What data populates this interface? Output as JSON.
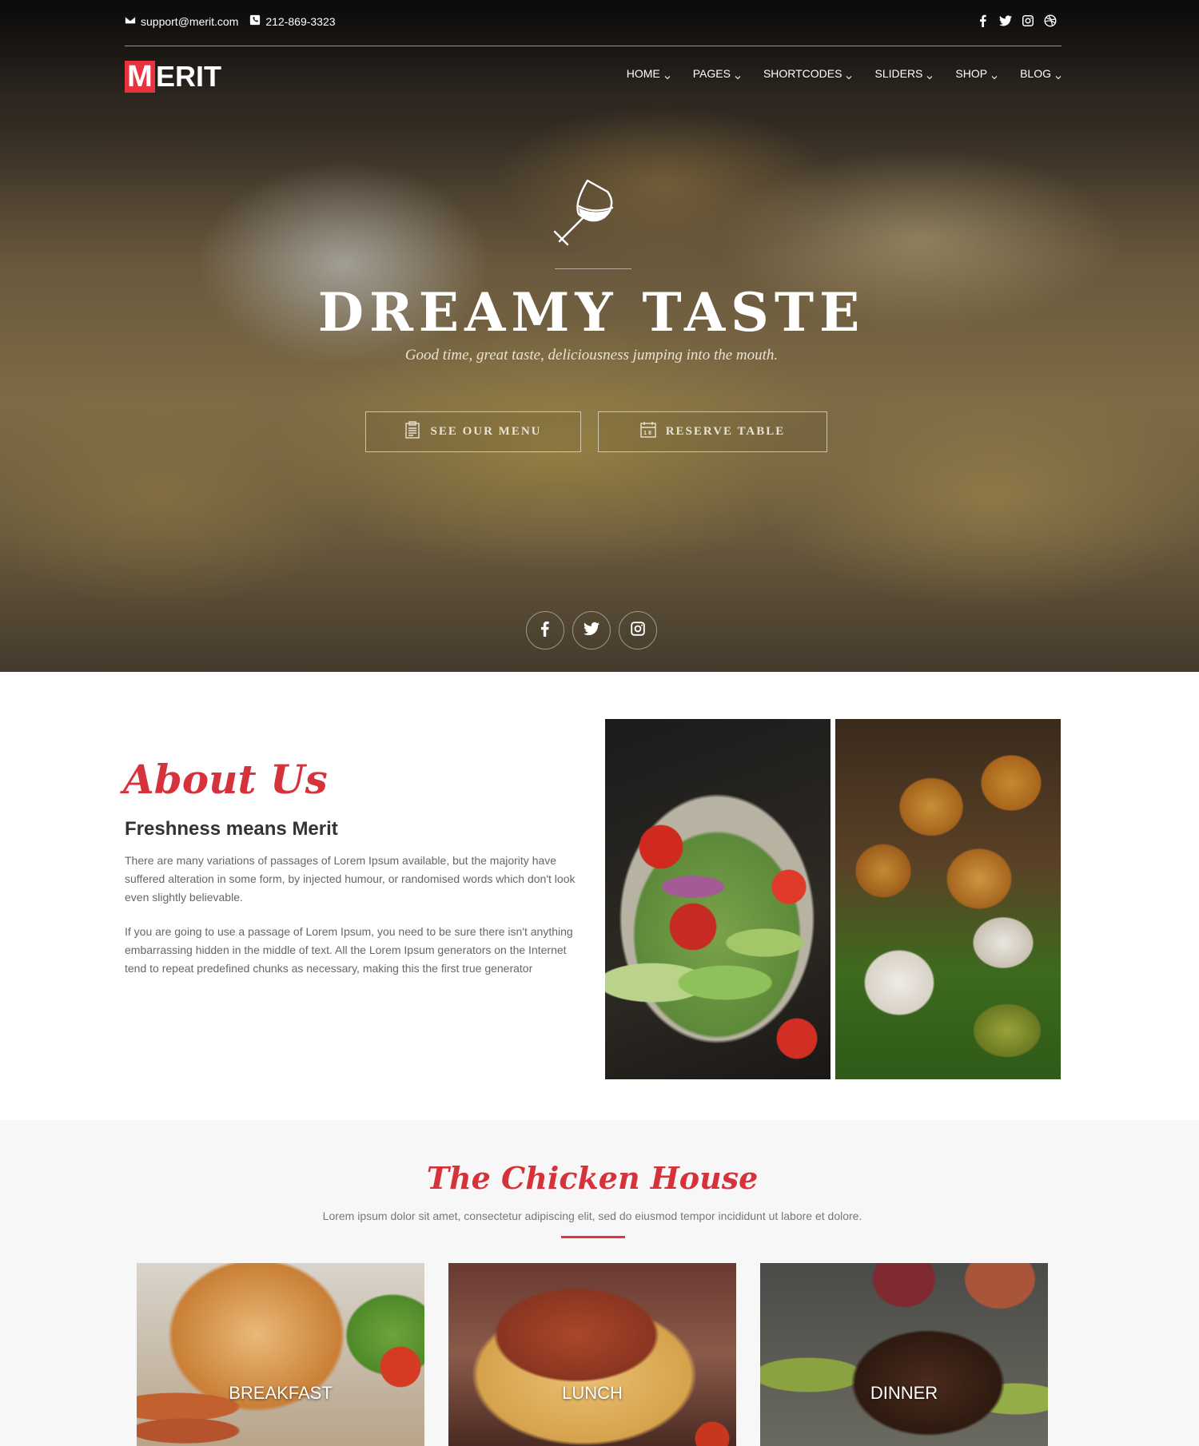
{
  "topbar": {
    "email": "support@merit.com",
    "phone": "212-869-3323",
    "social_icons": [
      "facebook-icon",
      "twitter-icon",
      "instagram-icon",
      "dribbble-icon"
    ]
  },
  "logo": {
    "first_letter": "M",
    "rest": "ERIT"
  },
  "nav": {
    "items": [
      {
        "label": "HOME"
      },
      {
        "label": "PAGES"
      },
      {
        "label": "SHORTCODES"
      },
      {
        "label": "SLIDERS"
      },
      {
        "label": "SHOP"
      },
      {
        "label": "BLOG"
      }
    ]
  },
  "hero": {
    "icon": "wine-glass-icon",
    "title": "DREAMY TASTE",
    "subtitle": "Good time, great taste, deliciousness jumping into the mouth.",
    "buttons": {
      "menu": "SEE OUR MENU",
      "reserve": "RESERVE TABLE"
    },
    "social_icons": [
      "facebook-icon",
      "twitter-icon",
      "instagram-icon"
    ]
  },
  "about": {
    "script_title": "About Us",
    "heading": "Freshness means Merit",
    "paragraph1": "There are many variations of passages of Lorem Ipsum available, but the majority have suffered alteration in some form, by injected humour, or randomised words which don't look even slightly believable.",
    "paragraph2": "If you are going to use a passage of Lorem Ipsum, you need to be sure there isn't anything embarrassing hidden in the middle of text. All the Lorem Ipsum generators on the Internet tend to repeat predefined chunks as necessary, making this the first true generator"
  },
  "chicken_house": {
    "title": "The Chicken House",
    "subtitle": "Lorem ipsum dolor sit amet, consectetur adipiscing elit, sed do eiusmod tempor incididunt ut labore et dolore.",
    "cards": [
      {
        "label": "BREAKFAST"
      },
      {
        "label": "LUNCH"
      },
      {
        "label": "DINNER"
      }
    ]
  },
  "colors": {
    "accent": "#e8323e",
    "script_red": "#d6323c",
    "text_gray": "#666666",
    "section_bg": "#f7f7f7"
  }
}
